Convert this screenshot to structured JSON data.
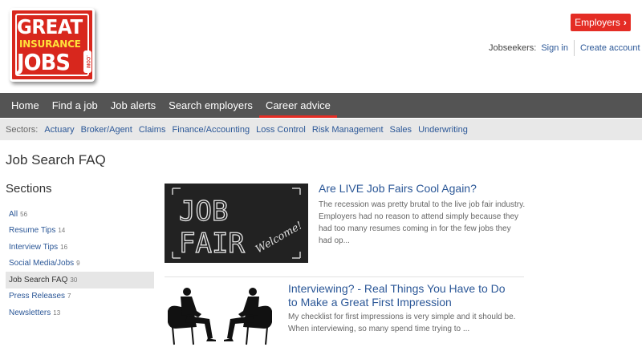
{
  "logo": {
    "line1": "GREAT",
    "line2": "INSURANCE",
    "line3": "JOBS",
    "tld": ".COM"
  },
  "header": {
    "employers_label": "Employers",
    "jobseekers_label": "Jobseekers:",
    "signin_label": "Sign in",
    "create_account_label": "Create account"
  },
  "nav": {
    "items": [
      {
        "label": "Home"
      },
      {
        "label": "Find a job"
      },
      {
        "label": "Job alerts"
      },
      {
        "label": "Search employers"
      },
      {
        "label": "Career advice"
      }
    ],
    "active": "Career advice"
  },
  "sectors": {
    "label": "Sectors:",
    "items": [
      "Actuary",
      "Broker/Agent",
      "Claims",
      "Finance/Accounting",
      "Loss Control",
      "Risk Management",
      "Sales",
      "Underwriting"
    ]
  },
  "page": {
    "title": "Job Search FAQ",
    "sections_title": "Sections"
  },
  "sidebar": {
    "items": [
      {
        "label": "All",
        "count": "56"
      },
      {
        "label": "Resume Tips",
        "count": "14"
      },
      {
        "label": "Interview Tips",
        "count": "16"
      },
      {
        "label": "Social Media/Jobs",
        "count": "9"
      },
      {
        "label": "Job Search FAQ",
        "count": "30"
      },
      {
        "label": "Press Releases",
        "count": "7"
      },
      {
        "label": "Newsletters",
        "count": "13"
      }
    ],
    "active": "Job Search FAQ"
  },
  "articles": [
    {
      "title": "Are LIVE Job Fairs Cool Again?",
      "excerpt": "The recession was pretty brutal to the live job fair industry. Employers had no reason to attend simply because they had too many resumes coming in for the few jobs they had op...",
      "image_text": {
        "line1": "JOB",
        "line2": "FAIR",
        "welcome": "Welcome!"
      }
    },
    {
      "title": "Interviewing? - Real Things You Have to Do to Make a Great First Impression",
      "excerpt": "My checklist for first impressions is very simple and it should be. When interviewing, so many spend time trying to ..."
    }
  ],
  "colors": {
    "accent": "#e42d25",
    "link": "#2b5797",
    "nav_bg": "#545454",
    "sector_bg": "#e8e8e8"
  }
}
